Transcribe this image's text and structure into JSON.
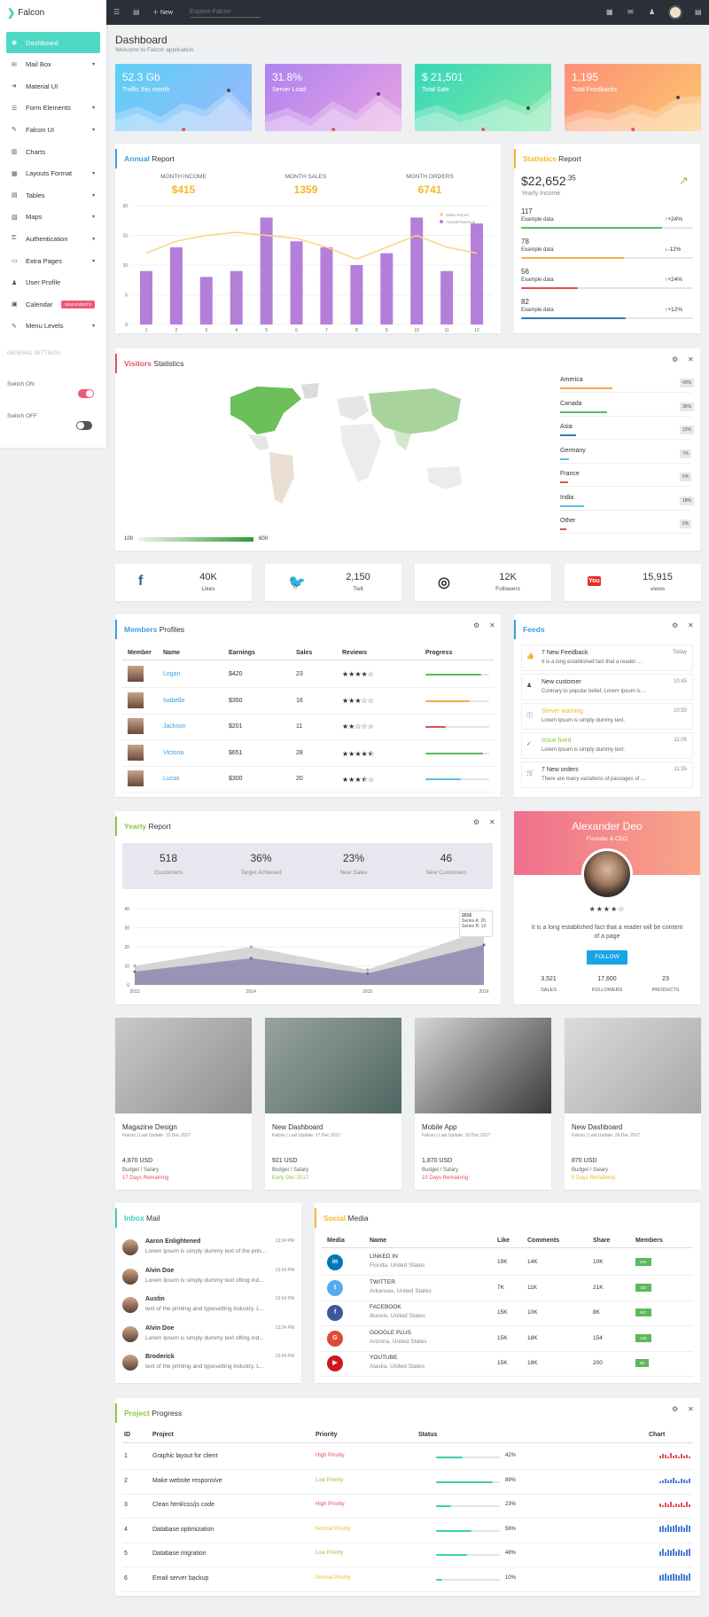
{
  "app": {
    "logo_text": "Falcon"
  },
  "topbar": {
    "new_label": "New",
    "search_placeholder": "Explore Falcon"
  },
  "sidebar": {
    "items": [
      {
        "label": "Dashboard",
        "icon": "dashboard-icon",
        "caret": false,
        "active": true
      },
      {
        "label": "Mail Box",
        "icon": "mail-icon",
        "caret": true
      },
      {
        "label": "Material UI",
        "icon": "arrow-icon",
        "caret": false
      },
      {
        "label": "Form Elements",
        "icon": "form-icon",
        "caret": true
      },
      {
        "label": "Falcon UI",
        "icon": "brush-icon",
        "caret": true
      },
      {
        "label": "Charts",
        "icon": "chart-icon",
        "caret": false
      },
      {
        "label": "Layouts Format",
        "icon": "layout-icon",
        "caret": true
      },
      {
        "label": "Tables",
        "icon": "table-icon",
        "caret": true
      },
      {
        "label": "Maps",
        "icon": "map-icon",
        "caret": true
      },
      {
        "label": "Authentication",
        "icon": "lock-icon",
        "caret": true
      },
      {
        "label": "Extra Pages",
        "icon": "pages-icon",
        "caret": true
      },
      {
        "label": "User Profile",
        "icon": "user-icon",
        "caret": false
      },
      {
        "label": "Calendar",
        "icon": "calendar-icon",
        "caret": false,
        "badge": "NEW EVENTS"
      },
      {
        "label": "Menu Levels",
        "icon": "menu-icon",
        "caret": true
      }
    ],
    "general_settings": "GENERAL SETTINGS",
    "switch_on": "Switch ON",
    "switch_off": "Switch OFF"
  },
  "page": {
    "title": "Dashboard",
    "subtitle": "Welcome to Falcon application"
  },
  "stats": [
    {
      "value": "52.3 Gb",
      "label": "Traffic this month",
      "colors": [
        "#5bd0f5",
        "#9db7fb"
      ]
    },
    {
      "value": "31.8%",
      "label": "Server Load",
      "colors": [
        "#b083f0",
        "#e7a3e2"
      ]
    },
    {
      "value": "$ 21,501",
      "label": "Total Sale",
      "colors": [
        "#37d7b9",
        "#7ee8a4"
      ]
    },
    {
      "value": "1,195",
      "label": "Total Feedbacks",
      "colors": [
        "#fd8f7a",
        "#fbc76b"
      ]
    }
  ],
  "annual": {
    "title_hi": "Annual",
    "title_rest": "Report",
    "metrics": [
      {
        "label": "MONTH INCOME",
        "value": "$415"
      },
      {
        "label": "MONTH SALES",
        "value": "1359"
      },
      {
        "label": "MONTH ORDERS",
        "value": "6741"
      }
    ],
    "legend": [
      "Sales Report",
      "Annual Revenue"
    ]
  },
  "chart_data": {
    "type": "bar",
    "categories": [
      "1",
      "2",
      "3",
      "4",
      "5",
      "6",
      "7",
      "8",
      "9",
      "10",
      "11",
      "12"
    ],
    "series": [
      {
        "name": "Annual Revenue",
        "type": "bar",
        "values": [
          9,
          13,
          8,
          9,
          18,
          14,
          13,
          10,
          12,
          18,
          9,
          17
        ]
      },
      {
        "name": "Sales Report",
        "type": "line",
        "values": [
          12,
          14,
          15,
          15.5,
          15,
          14.5,
          13,
          11,
          13,
          15,
          13,
          12
        ]
      }
    ],
    "ylim": [
      0,
      20
    ],
    "yticks": [
      "0",
      "5",
      "10",
      "15",
      "20"
    ],
    "colors": {
      "bar": "#b37fd9",
      "line": "#fad580"
    }
  },
  "statistics": {
    "title_hi": "Statistics",
    "title_rest": "Report",
    "amount": "$22,652",
    "amount_sup": ".35",
    "amount_label": "Yearly Income",
    "rows": [
      {
        "value": "117",
        "label": "Example data",
        "change": "+24%",
        "dir": "↑",
        "pct": 0.82,
        "color": "#5cb85c"
      },
      {
        "value": "78",
        "label": "Example data",
        "change": "-12%",
        "dir": "↓",
        "pct": 0.6,
        "color": "#f0ad4e"
      },
      {
        "value": "56",
        "label": "Example data",
        "change": "+24%",
        "dir": "↑",
        "pct": 0.33,
        "color": "#d9534f"
      },
      {
        "value": "82",
        "label": "Example data",
        "change": "+12%",
        "dir": "↑",
        "pct": 0.61,
        "color": "#337ab7"
      }
    ]
  },
  "visitors": {
    "title_hi": "Visitors",
    "title_rest": "Statistics",
    "scale_min": "100",
    "scale_max": "600",
    "countries": [
      {
        "name": "America",
        "pct": "40%",
        "fill": 0.4,
        "color": "#f0ad4e"
      },
      {
        "name": "Canada",
        "pct": "36%",
        "fill": 0.36,
        "color": "#5cb85c"
      },
      {
        "name": "Asia",
        "pct": "12%",
        "fill": 0.12,
        "color": "#337ab7"
      },
      {
        "name": "Germany",
        "pct": "7%",
        "fill": 0.07,
        "color": "#5bc0de"
      },
      {
        "name": "France",
        "pct": "6%",
        "fill": 0.06,
        "color": "#d9534f"
      },
      {
        "name": "India",
        "pct": "18%",
        "fill": 0.18,
        "color": "#5bc0de"
      },
      {
        "name": "Other",
        "pct": "5%",
        "fill": 0.05,
        "color": "#d9534f"
      }
    ]
  },
  "social_stats": [
    {
      "value": "40K",
      "label": "Likes",
      "icon": "facebook-icon",
      "color": "#3b5998"
    },
    {
      "value": "2,150",
      "label": "Twit",
      "icon": "twitter-icon",
      "color": "#1da1f2"
    },
    {
      "value": "12K",
      "label": "Followers",
      "icon": "instagram-icon",
      "color": "#333333"
    },
    {
      "value": "15,915",
      "label": "views",
      "icon": "youtube-icon",
      "color": "#e52d27"
    }
  ],
  "members": {
    "title_hi": "Members",
    "title_rest": "Profiles",
    "headers": [
      "Member",
      "Name",
      "Earnings",
      "Sales",
      "Reviews",
      "Progress"
    ],
    "rows": [
      {
        "name": "Logan",
        "earnings": "$420",
        "sales": "23",
        "stars": "★★★★☆",
        "pct": 0.88,
        "color": "#5cb85c"
      },
      {
        "name": "Isabella",
        "earnings": "$350",
        "sales": "16",
        "stars": "★★★☆☆",
        "pct": 0.7,
        "color": "#f0ad4e"
      },
      {
        "name": "Jackson",
        "earnings": "$201",
        "sales": "11",
        "stars": "★★☆☆☆",
        "pct": 0.32,
        "color": "#d9534f"
      },
      {
        "name": "Victoria",
        "earnings": "$651",
        "sales": "28",
        "stars": "★★★★⯪",
        "pct": 0.9,
        "color": "#5cb85c"
      },
      {
        "name": "Lucas",
        "earnings": "$300",
        "sales": "20",
        "stars": "★★★⯪☆",
        "pct": 0.55,
        "color": "#5bc0de"
      }
    ]
  },
  "feeds": {
    "title": "Feeds",
    "items": [
      {
        "title": "7 New Feedback",
        "text": "It is a long established fact that a reader ...",
        "time": "Today",
        "icon": "thumbs-up-icon",
        "color": "#333"
      },
      {
        "title": "New customer",
        "text": "Contrary to popular belief, Lorem Ipsum is ...",
        "time": "10:45",
        "icon": "user-icon",
        "color": "#333"
      },
      {
        "title": "Server warning",
        "text": "Lorem Ipsum is simply dummy text.",
        "time": "10:50",
        "icon": "info-icon",
        "color": "#f5b727"
      },
      {
        "title": "Issue fixed",
        "text": "Lorem Ipsum is simply dummy text.",
        "time": "11:05",
        "icon": "check-icon",
        "color": "#8cc63f"
      },
      {
        "title": "7 New orders",
        "text": "There are many variations of passages of ...",
        "time": "11:35",
        "icon": "cart-icon",
        "color": "#333"
      }
    ]
  },
  "yearly": {
    "title_hi": "Yearly",
    "title_rest": "Report",
    "kpis": [
      {
        "value": "518",
        "label": "Customers"
      },
      {
        "value": "36%",
        "label": "Target Achieved"
      },
      {
        "value": "23%",
        "label": "New Sales"
      },
      {
        "value": "46",
        "label": "New Customers"
      }
    ],
    "tooltip": {
      "title": "2016",
      "a": "Series A: 20",
      "b": "Series B: 13"
    }
  },
  "yearly_chart": {
    "type": "area",
    "x": [
      "2013",
      "2014",
      "2015",
      "2016"
    ],
    "series": [
      {
        "name": "Series A",
        "values": [
          10,
          20,
          8,
          29
        ]
      },
      {
        "name": "Series B",
        "values": [
          7,
          14,
          6,
          21
        ]
      }
    ],
    "ylim": [
      0,
      40
    ],
    "yticks": [
      "0",
      "10",
      "20",
      "30",
      "40"
    ]
  },
  "profile": {
    "name": "Alexander Deo",
    "role": "Founder & CEO",
    "stars": "★★★★☆",
    "bio": "It is a long established fact that a reader will be content of a page",
    "follow": "FOLLOW",
    "stats": [
      {
        "value": "3,521",
        "label": "SALES"
      },
      {
        "value": "17,600",
        "label": "FOLLOWERS"
      },
      {
        "value": "23",
        "label": "PRODUCTS"
      }
    ]
  },
  "projects_cards": [
    {
      "title": "Magazine Design",
      "meta": "Falcon | Last Update: 12 Dec 2017",
      "amount": "4,870 USD",
      "budget": "Budget / Salary",
      "due": "17 Days Remaining",
      "due_color": "#e5505a",
      "img": [
        "#c9c9c9",
        "#8f8f8f"
      ]
    },
    {
      "title": "New Dashboard",
      "meta": "Falcon | Last Update: 17 Dec 2017",
      "amount": "921 USD",
      "budget": "Budget / Salary",
      "due": "Early Dec 2017",
      "due_color": "#8cc63f",
      "img": [
        "#9aa4a2",
        "#4e6661"
      ]
    },
    {
      "title": "Mobile App",
      "meta": "Falcon | Last Update: 31 Dec 2017",
      "amount": "1,870 USD",
      "budget": "Budget / Salary",
      "due": "10 Days Remaining",
      "due_color": "#e5505a",
      "img": [
        "#d7d7d7",
        "#3a3a3a"
      ]
    },
    {
      "title": "New Dashboard",
      "meta": "Falcon | Last Update: 26 Dec 2017",
      "amount": "870 USD",
      "budget": "Budget / Salary",
      "due": "8 Days Remaining",
      "due_color": "#f5b727",
      "img": [
        "#dcdcdc",
        "#a7a7a7"
      ]
    }
  ],
  "inbox": {
    "title_hi": "Inbox",
    "title_rest": "Mail",
    "items": [
      {
        "name": "Aaron Enlightened",
        "time": "13:34 PM",
        "text": "Lorem Ipsum is simply dummy text of the prin..."
      },
      {
        "name": "Alvin Doe",
        "time": "13:34 PM",
        "text": "Lorem Ipsum is simply dummy text ofting ind..."
      },
      {
        "name": "Austin",
        "time": "13:34 PM",
        "text": "text of the printing and typesetting industry. L..."
      },
      {
        "name": "Alvin Doe",
        "time": "13:34 PM",
        "text": "Lorem Ipsum is simply dummy text ofting ind..."
      },
      {
        "name": "Broderick",
        "time": "13:34 PM",
        "text": "text of the printing and typesetting industry. L..."
      }
    ]
  },
  "social_media": {
    "title_hi": "Social",
    "title_rest": "Media",
    "headers": [
      "Media",
      "Name",
      "Like",
      "Comments",
      "Share",
      "Members"
    ],
    "rows": [
      {
        "name": "LINKED IN",
        "loc": "Florida, United States",
        "like": "19K",
        "comments": "14K",
        "share": "10K",
        "members": "344",
        "color": "#0077b5",
        "glyph": "in",
        "icon": "linkedin-icon"
      },
      {
        "name": "TWITTER",
        "loc": "Arkansas, United States",
        "like": "7K",
        "comments": "11K",
        "share": "21K",
        "members": "182",
        "color": "#55acee",
        "glyph": "t",
        "icon": "twitter-icon"
      },
      {
        "name": "FACEBOOK",
        "loc": "Illunois, United States",
        "like": "15K",
        "comments": "10K",
        "share": "8K",
        "members": "507",
        "color": "#3b5998",
        "glyph": "f",
        "icon": "facebook-icon"
      },
      {
        "name": "GOOGLE PLUS",
        "loc": "Arizona, United States",
        "like": "15K",
        "comments": "18K",
        "share": "154",
        "members": "125",
        "color": "#dd4b39",
        "glyph": "G",
        "icon": "googleplus-icon"
      },
      {
        "name": "YOUTUBE",
        "loc": "Alaska, United States",
        "like": "15K",
        "comments": "18K",
        "share": "200",
        "members": "96",
        "color": "#cc181e",
        "glyph": "▶",
        "icon": "youtube-icon"
      }
    ]
  },
  "project_progress": {
    "title_hi": "Project",
    "title_rest": "Progress",
    "headers": [
      "ID",
      "Project",
      "Priority",
      "Status",
      "Chart"
    ],
    "rows": [
      {
        "id": "1",
        "project": "Graphic layout for client",
        "priority": "High Priority",
        "pcolor": "#e5505a",
        "status": "42%",
        "fill": 0.42,
        "bars": [
          3,
          5,
          4,
          2,
          6,
          3,
          4,
          2,
          5,
          3,
          4,
          2
        ],
        "bcolor": "#e5505a"
      },
      {
        "id": "2",
        "project": "Make website responsive",
        "priority": "Low Priority",
        "pcolor": "#8cc63f",
        "status": "89%",
        "fill": 0.89,
        "bars": [
          2,
          3,
          5,
          3,
          4,
          6,
          3,
          2,
          5,
          4,
          3,
          5
        ],
        "bcolor": "#4a7ed8"
      },
      {
        "id": "3",
        "project": "Clean html/css/js code",
        "priority": "High Priority",
        "pcolor": "#e5505a",
        "status": "23%",
        "fill": 0.23,
        "bars": [
          4,
          2,
          5,
          3,
          6,
          2,
          4,
          3,
          5,
          2,
          6,
          3
        ],
        "bcolor": "#e5505a"
      },
      {
        "id": "4",
        "project": "Database optimization",
        "priority": "Normal Priority",
        "pcolor": "#f5b727",
        "status": "56%",
        "fill": 0.56,
        "bars": [
          6,
          7,
          5,
          8,
          6,
          7,
          8,
          6,
          7,
          5,
          8,
          7
        ],
        "bcolor": "#4a7ed8"
      },
      {
        "id": "5",
        "project": "Database migration",
        "priority": "Low Priority",
        "pcolor": "#8cc63f",
        "status": "48%",
        "fill": 0.48,
        "bars": [
          5,
          8,
          4,
          7,
          6,
          8,
          5,
          7,
          6,
          4,
          7,
          8
        ],
        "bcolor": "#4a7ed8"
      },
      {
        "id": "6",
        "project": "Email server backup",
        "priority": "Normal Priority",
        "pcolor": "#f5b727",
        "status": "10%",
        "fill": 0.1,
        "bars": [
          6,
          7,
          8,
          6,
          7,
          8,
          7,
          6,
          8,
          7,
          6,
          8
        ],
        "bcolor": "#4a7ed8"
      }
    ]
  }
}
